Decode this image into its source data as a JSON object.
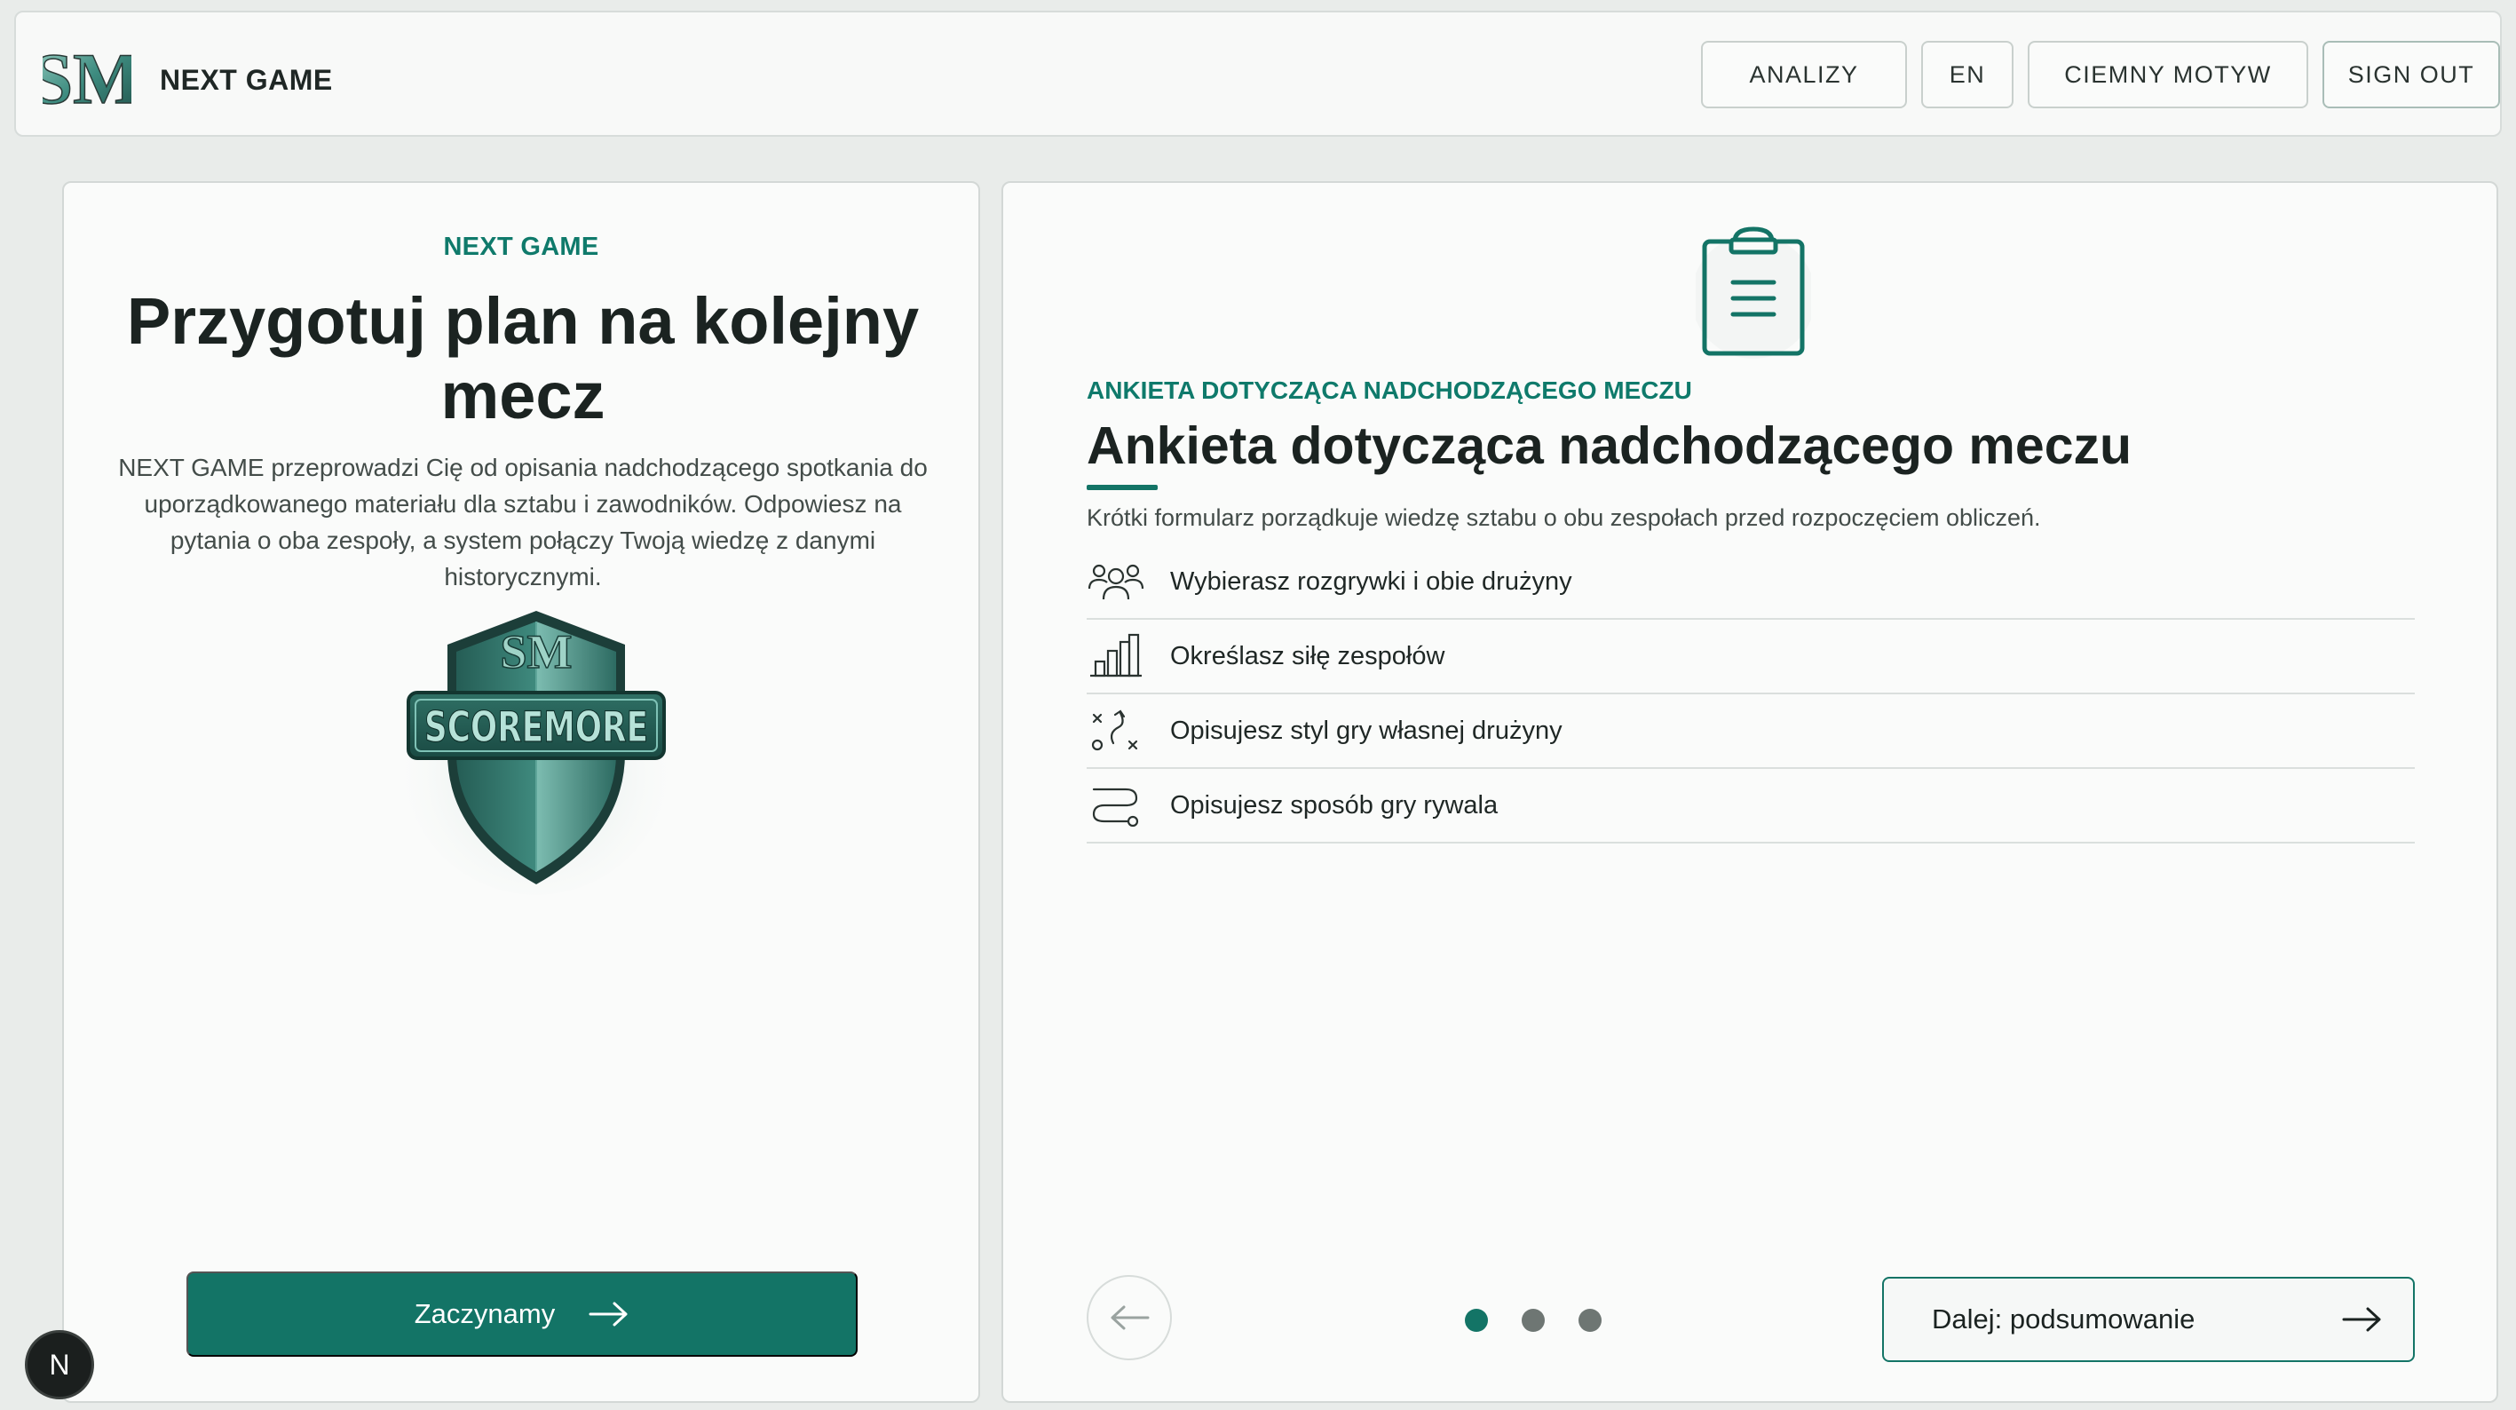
{
  "header": {
    "brand_logo_text": "SM",
    "brand_name": "NEXT GAME",
    "nav": {
      "analytics": "ANALIZY",
      "language": "EN",
      "theme": "CIEMNY MOTYW",
      "sign_out": "SIGN OUT"
    }
  },
  "intro": {
    "eyebrow": "NEXT GAME",
    "title": "Przygotuj plan na kolejny mecz",
    "description": "NEXT GAME przeprowadzi Cię od opisania nadchodzącego spotkania do uporządkowanego materiału dla sztabu i zawodników. Odpowiesz na pytania o oba zespoły, a system połączy Twoją wiedzę z danymi historycznymi.",
    "crest_text": "SCOREMORE",
    "crest_monogram": "SM",
    "start_button": "Zaczynamy"
  },
  "survey": {
    "icon": "clipboard-icon",
    "eyebrow": "ANKIETA DOTYCZĄCA NADCHODZĄCEGO MECZU",
    "title": "Ankieta dotycząca nadchodzącego meczu",
    "description": "Krótki formularz porządkuje wiedzę sztabu o obu zespołach przed rozpoczęciem obliczeń.",
    "steps": [
      {
        "icon": "team-icon",
        "label": "Wybierasz rozgrywki i obie drużyny"
      },
      {
        "icon": "bar-chart-icon",
        "label": "Określasz siłę zespołów"
      },
      {
        "icon": "tactics-icon",
        "label": "Opisujesz styl gry własnej drużyny"
      },
      {
        "icon": "route-icon",
        "label": "Opisujesz sposób gry rywala"
      }
    ],
    "pagination": {
      "total": 3,
      "active": 1
    },
    "next_button": "Dalej: podsumowanie"
  },
  "badge": {
    "letter": "N"
  },
  "colors": {
    "accent": "#137466",
    "accent_text": "#0f7a6b",
    "background": "#e9ecea",
    "panel": "#fafbfa"
  }
}
